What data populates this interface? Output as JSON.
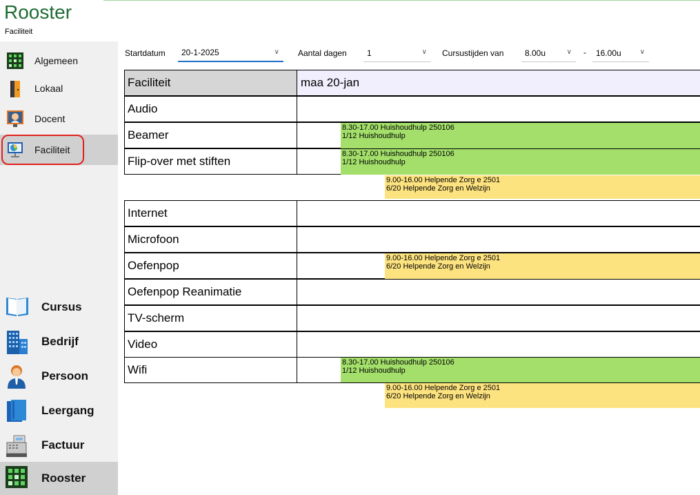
{
  "app": {
    "title": "Rooster",
    "subtitle": "Faciliteit"
  },
  "sidebar": {
    "items": [
      {
        "label": "Algemeen",
        "icon": "grid-icon"
      },
      {
        "label": "Lokaal",
        "icon": "door-icon"
      },
      {
        "label": "Docent",
        "icon": "teacher-icon"
      },
      {
        "label": "Faciliteit",
        "icon": "presentation-icon",
        "selected": true
      }
    ],
    "modules": [
      {
        "label": "Cursus",
        "icon": "book-icon"
      },
      {
        "label": "Bedrijf",
        "icon": "building-icon"
      },
      {
        "label": "Persoon",
        "icon": "person-icon"
      },
      {
        "label": "Leergang",
        "icon": "binder-icon"
      },
      {
        "label": "Factuur",
        "icon": "cash-register-icon"
      },
      {
        "label": "Rooster",
        "icon": "grid-icon",
        "selected": true
      }
    ]
  },
  "toolbar": {
    "startdatum_label": "Startdatum",
    "startdatum_value": "20-1-2025",
    "aantal_dagen_label": "Aantal dagen",
    "aantal_dagen_value": "1",
    "cursustijden_label": "Cursustijden van",
    "cursustijden_from": "8.00u",
    "dash": "-",
    "cursustijden_to": "16.00u"
  },
  "grid": {
    "header": {
      "name": "Faciliteit",
      "day": "maa 20-jan"
    },
    "rows": [
      {
        "name": "Audio"
      },
      {
        "name": "Beamer"
      },
      {
        "name": "Flip-over met stiften"
      },
      {
        "name": "Internet"
      },
      {
        "name": "Microfoon"
      },
      {
        "name": "Oefenpop"
      },
      {
        "name": "Oefenpop Reanimatie"
      },
      {
        "name": "TV-scherm"
      },
      {
        "name": "Video"
      },
      {
        "name": "Wifi"
      }
    ],
    "bookings": {
      "huishoud_line1": "8.30-17.00 Huishoudhulp 250106",
      "huishoud_line2": "1/12 Huishoudhulp",
      "zorg_line1": "9.00-16.00 Helpende Zorg e 2501",
      "zorg_line2": "6/20 Helpende Zorg en Welzijn"
    }
  },
  "colors": {
    "green_booking": "#a3df6a",
    "yellow_booking": "#fde37f",
    "accent": "#1e70c8",
    "title": "#1f6b34"
  }
}
